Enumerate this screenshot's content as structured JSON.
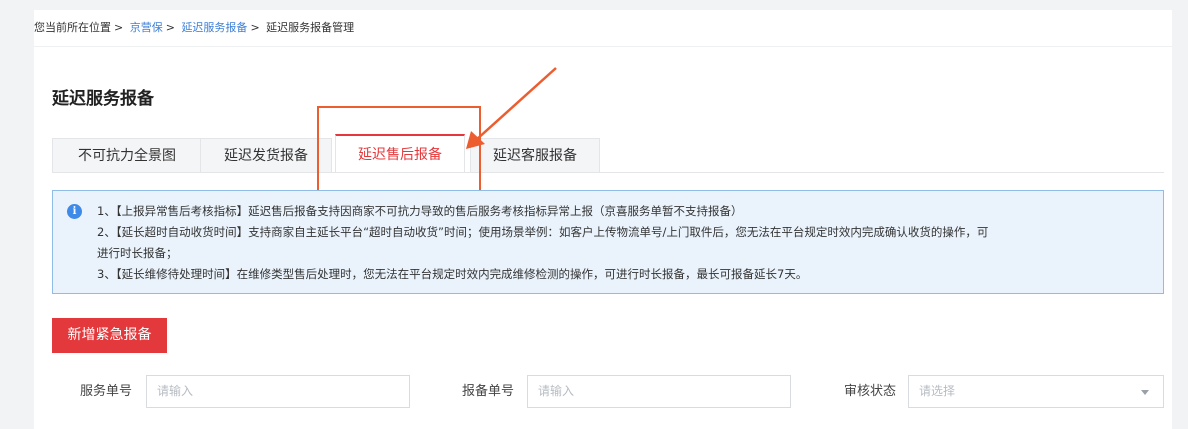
{
  "breadcrumb": {
    "prefix": "您当前所在位置",
    "sep": ">",
    "items": [
      "京营保",
      "延迟服务报备",
      "延迟服务报备管理"
    ]
  },
  "page_title": "延迟服务报备",
  "tabs": [
    "不可抗力全景图",
    "延迟发货报备",
    "延迟售后报备",
    "延迟客服报备"
  ],
  "active_tab_index": 2,
  "notice": {
    "icon": "info-icon",
    "lines": [
      "1、【上报异常售后考核指标】延迟售后报备支持因商家不可抗力导致的售后服务考核指标异常上报（京喜服务单暂不支持报备）",
      "2、【延长超时自动收货时间】支持商家自主延长平台“超时自动收货”时间；使用场景举例：如客户上传物流单号/上门取件后，您无法在平台规定时效内完成确认收货的操作，可",
      "进行时长报备；",
      "3、【延长维修待处理时间】在维修类型售后处理时，您无法在平台规定时效内完成维修检测的操作，可进行时长报备，最长可报备延长7天。"
    ]
  },
  "add_button": "新增紧急报备",
  "filters": {
    "service_no": {
      "label": "服务单号",
      "placeholder": "请输入"
    },
    "report_no": {
      "label": "报备单号",
      "placeholder": "请输入"
    },
    "audit_status": {
      "label": "审核状态",
      "placeholder": "请选择"
    }
  },
  "colors": {
    "accent": "#e4393c",
    "link": "#3e7fd6",
    "annotation": "#ec5d2f",
    "notice_bg": "#eaf3fc"
  }
}
